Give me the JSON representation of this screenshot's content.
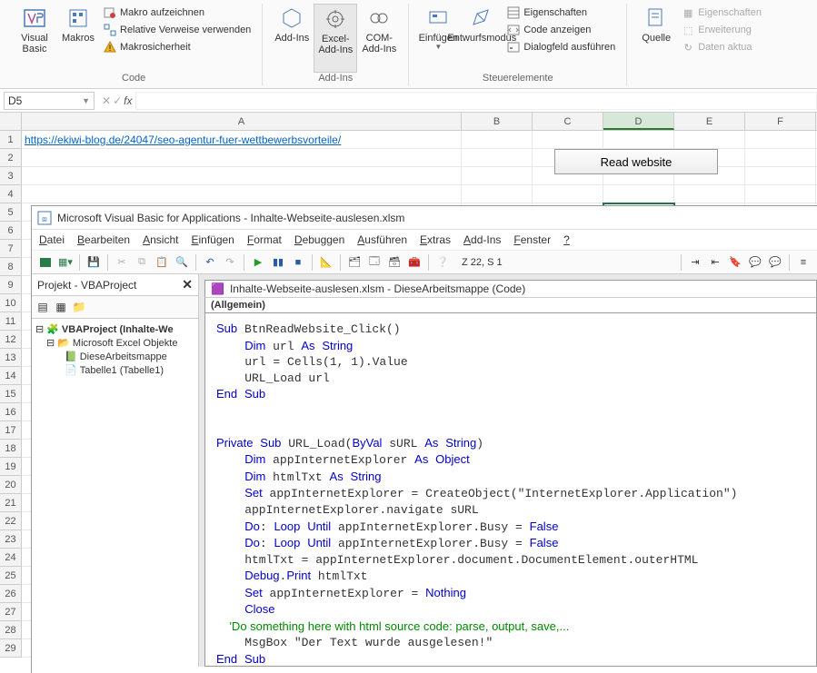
{
  "ribbon": {
    "groups": {
      "code": {
        "label": "Code",
        "visual_basic": "Visual Basic",
        "makros": "Makros",
        "makro_aufzeichnen": "Makro aufzeichnen",
        "relative_verweise": "Relative Verweise verwenden",
        "makrosicherheit": "Makrosicherheit"
      },
      "addins": {
        "label": "Add-Ins",
        "addins": "Add-Ins",
        "excel_addins": "Excel-Add-Ins",
        "com_addins": "COM-Add-Ins"
      },
      "insert": {
        "einfuegen": "Einfügen"
      },
      "controls": {
        "label": "Steuerelemente",
        "entwurfsmodus": "Entwurfsmodus",
        "eigenschaften": "Eigenschaften",
        "code_anzeigen": "Code anzeigen",
        "dialogfeld": "Dialogfeld ausführen"
      },
      "xml": {
        "quelle": "Quelle",
        "eigenschaften": "Eigenschaften",
        "erweiterung": "Erweiterung",
        "daten_aktua": "Daten aktua"
      }
    }
  },
  "namebox": "D5",
  "cells": {
    "A1": "https://ekiwi-blog.de/24047/seo-agentur-fuer-wettbewerbsvorteile/"
  },
  "read_button": "Read website",
  "columns": [
    "A",
    "B",
    "C",
    "D",
    "E",
    "F"
  ],
  "selected_col": "D",
  "row_count": 29,
  "vbe": {
    "title": "Microsoft Visual Basic for Applications - Inhalte-Webseite-auslesen.xlsm",
    "menu": [
      "Datei",
      "Bearbeiten",
      "Ansicht",
      "Einfügen",
      "Format",
      "Debuggen",
      "Ausführen",
      "Extras",
      "Add-Ins",
      "Fenster",
      "?"
    ],
    "cursor_pos": "Z 22, S 1",
    "project": {
      "pane_title": "Projekt - VBAProject",
      "root": "VBAProject (Inhalte-We",
      "folder": "Microsoft Excel Objekte",
      "items": [
        "DieseArbeitsmappe",
        "Tabelle1 (Tabelle1)"
      ]
    },
    "code_window": {
      "title": "Inhalte-Webseite-auslesen.xlsm - DieseArbeitsmappe (Code)",
      "dropdown": "(Allgemein)"
    },
    "code": {
      "l1": "Sub BtnReadWebsite_Click()",
      "l2": "    Dim url As String",
      "l3": "    url = Cells(1, 1).Value",
      "l4": "    URL_Load url",
      "l5": "End Sub",
      "l6": "",
      "l7": "",
      "l8": "Private Sub URL_Load(ByVal sURL As String)",
      "l9": "    Dim appInternetExplorer As Object",
      "l10": "    Dim htmlTxt As String",
      "l11": "    Set appInternetExplorer = CreateObject(\"InternetExplorer.Application\")",
      "l12": "    appInternetExplorer.navigate sURL",
      "l13": "    Do: Loop Until appInternetExplorer.Busy = False",
      "l14": "    Do: Loop Until appInternetExplorer.Busy = False",
      "l15": "    htmlTxt = appInternetExplorer.document.DocumentElement.outerHTML",
      "l16": "    Debug.Print htmlTxt",
      "l17": "    Set appInternetExplorer = Nothing",
      "l18": "    Close",
      "l19": "    'Do something here with html source code: parse, output, save,...",
      "l20": "    MsgBox \"Der Text wurde ausgelesen!\"",
      "l21": "End Sub"
    }
  }
}
